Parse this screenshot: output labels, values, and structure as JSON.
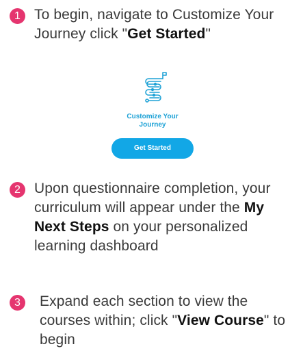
{
  "steps": [
    {
      "number": "1",
      "text_before": "To begin, navigate to Customize Your Journey click \"",
      "bold": "Get Started",
      "text_after": "\""
    },
    {
      "number": "2",
      "text_before": "Upon questionnaire completion, your curriculum will appear under the ",
      "bold": "My Next Steps",
      "text_after": " on your personalized learning dashboard"
    },
    {
      "number": "3",
      "text_before": "Expand each section to view the courses within; click \"",
      "bold": "View Course",
      "text_after": "\" to begin"
    }
  ],
  "card": {
    "icon": "journey-path-icon",
    "title_line1": "Customize Your",
    "title_line2": "Journey",
    "button_label": "Get Started",
    "accent_color": "#12a7e6"
  },
  "colors": {
    "step_badge": "#e5356f",
    "body_text": "#3a3a3a"
  }
}
